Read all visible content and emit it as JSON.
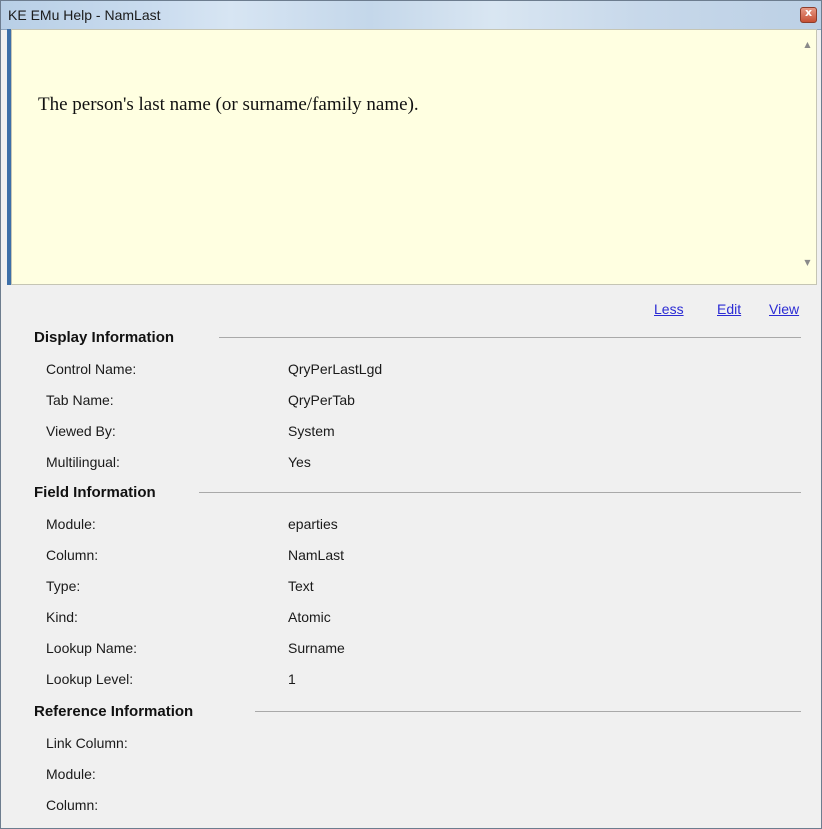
{
  "window": {
    "title": "KE EMu Help - NamLast",
    "close_label": "x"
  },
  "description": {
    "text": "The person's last name (or surname/family name)."
  },
  "links": {
    "less": "Less",
    "edit": "Edit",
    "view": "View"
  },
  "sections": [
    {
      "title": "Display Information",
      "rows": [
        {
          "label": "Control Name:",
          "value": "QryPerLastLgd"
        },
        {
          "label": "Tab Name:",
          "value": "QryPerTab"
        },
        {
          "label": "Viewed By:",
          "value": "System"
        },
        {
          "label": "Multilingual:",
          "value": "Yes"
        }
      ]
    },
    {
      "title": "Field Information",
      "rows": [
        {
          "label": "Module:",
          "value": "eparties"
        },
        {
          "label": "Column:",
          "value": "NamLast"
        },
        {
          "label": "Type:",
          "value": "Text"
        },
        {
          "label": "Kind:",
          "value": "Atomic"
        },
        {
          "label": "Lookup Name:",
          "value": "Surname"
        },
        {
          "label": "Lookup Level:",
          "value": "1"
        }
      ]
    },
    {
      "title": "Reference Information",
      "rows": [
        {
          "label": "Link Column:",
          "value": ""
        },
        {
          "label": "Module:",
          "value": ""
        },
        {
          "label": "Column:",
          "value": ""
        }
      ]
    }
  ]
}
